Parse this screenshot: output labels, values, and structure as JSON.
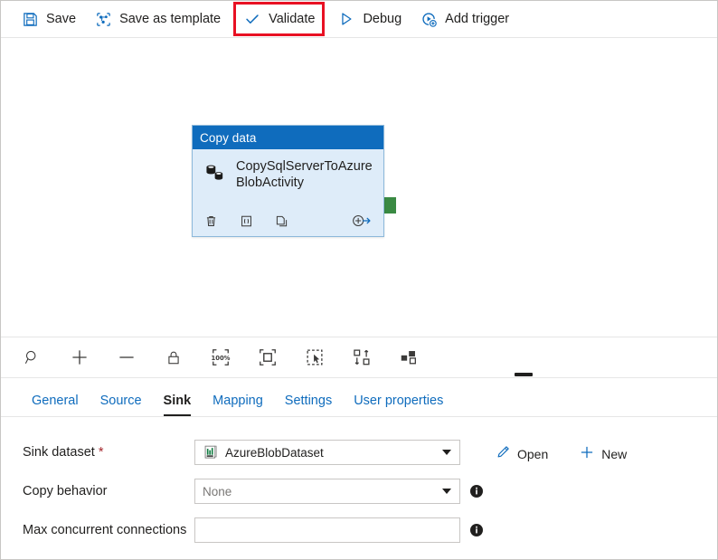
{
  "toolbar": {
    "items": [
      {
        "label": "Save",
        "icon": "save-icon",
        "highlighted": false
      },
      {
        "label": "Save as template",
        "icon": "save-as-template-icon",
        "highlighted": false
      },
      {
        "label": "Validate",
        "icon": "checkmark-icon",
        "highlighted": true
      },
      {
        "label": "Debug",
        "icon": "play-triangle-icon",
        "highlighted": false
      },
      {
        "label": "Add trigger",
        "icon": "add-trigger-icon",
        "highlighted": false
      }
    ],
    "highlight_color": "#e81123",
    "accent_color": "#0f6cbd"
  },
  "canvas": {
    "node": {
      "header": "Copy data",
      "title": "CopySqlServerToAzureBlobActivity",
      "header_color": "#0f6cbd",
      "body_color": "#deecf9",
      "actions": [
        {
          "name": "delete-icon",
          "glyph": "trash"
        },
        {
          "name": "code-icon",
          "glyph": "braces"
        },
        {
          "name": "clone-icon",
          "glyph": "copy"
        },
        {
          "name": "add-output-icon",
          "glyph": "plus-arrow"
        }
      ],
      "connector_color": "#3a8a43",
      "status_circle_color": "#e81123"
    },
    "tools": [
      {
        "name": "zoom-icon",
        "label": "Zoom"
      },
      {
        "name": "zoom-in-icon",
        "label": "Zoom in"
      },
      {
        "name": "zoom-out-icon",
        "label": "Zoom out"
      },
      {
        "name": "lock-icon",
        "label": "Lock"
      },
      {
        "name": "zoom-100-icon",
        "label": "100%"
      },
      {
        "name": "zoom-to-fit-icon",
        "label": "Zoom to fit"
      },
      {
        "name": "select-region-icon",
        "label": "Select"
      },
      {
        "name": "auto-align-icon",
        "label": "Auto align"
      },
      {
        "name": "layout-icon",
        "label": "Layout"
      }
    ],
    "zoom_level": "100%"
  },
  "tabs": [
    {
      "label": "General",
      "active": false
    },
    {
      "label": "Source",
      "active": false
    },
    {
      "label": "Sink",
      "active": true
    },
    {
      "label": "Mapping",
      "active": false
    },
    {
      "label": "Settings",
      "active": false
    },
    {
      "label": "User properties",
      "active": false
    }
  ],
  "form": {
    "sink_dataset": {
      "label": "Sink dataset",
      "required_marker": "*",
      "value": "AzureBlobDataset",
      "icon": "csv-dataset-icon",
      "open_label": "Open",
      "new_label": "New"
    },
    "copy_behavior": {
      "label": "Copy behavior",
      "value": "None",
      "is_placeholder": true,
      "info": "i"
    },
    "max_concurrent_connections": {
      "label": "Max concurrent connections",
      "value": "",
      "placeholder": "",
      "info": "i"
    }
  }
}
